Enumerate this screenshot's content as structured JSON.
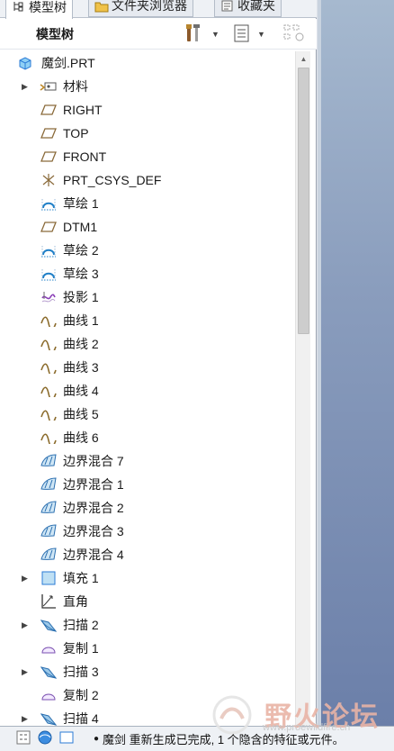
{
  "tabs": [
    {
      "label": "模型树",
      "icon": "model-tree-icon"
    },
    {
      "label": "文件夹浏览器",
      "icon": "folder-icon"
    },
    {
      "label": "收藏夹",
      "icon": "favorites-icon"
    }
  ],
  "header": {
    "title": "模型树"
  },
  "tree": {
    "root": "魔剑.PRT",
    "items": [
      {
        "label": "材料",
        "icon": "material-icon",
        "expandable": true
      },
      {
        "label": "RIGHT",
        "icon": "datum-plane-icon",
        "expandable": false
      },
      {
        "label": "TOP",
        "icon": "datum-plane-icon",
        "expandable": false
      },
      {
        "label": "FRONT",
        "icon": "datum-plane-icon",
        "expandable": false
      },
      {
        "label": "PRT_CSYS_DEF",
        "icon": "csys-icon",
        "expandable": false
      },
      {
        "label": "草绘 1",
        "icon": "sketch-icon",
        "expandable": false
      },
      {
        "label": "DTM1",
        "icon": "datum-plane-icon",
        "expandable": false
      },
      {
        "label": "草绘 2",
        "icon": "sketch-icon",
        "expandable": false
      },
      {
        "label": "草绘 3",
        "icon": "sketch-icon",
        "expandable": false
      },
      {
        "label": "投影 1",
        "icon": "projection-icon",
        "expandable": false
      },
      {
        "label": "曲线 1",
        "icon": "curve-icon",
        "expandable": false
      },
      {
        "label": "曲线 2",
        "icon": "curve-icon",
        "expandable": false
      },
      {
        "label": "曲线 3",
        "icon": "curve-icon",
        "expandable": false
      },
      {
        "label": "曲线 4",
        "icon": "curve-icon",
        "expandable": false
      },
      {
        "label": "曲线 5",
        "icon": "curve-icon",
        "expandable": false
      },
      {
        "label": "曲线 6",
        "icon": "curve-icon",
        "expandable": false
      },
      {
        "label": "边界混合 7",
        "icon": "boundary-blend-icon",
        "expandable": false
      },
      {
        "label": "边界混合 1",
        "icon": "boundary-blend-icon",
        "expandable": false
      },
      {
        "label": "边界混合 2",
        "icon": "boundary-blend-icon",
        "expandable": false
      },
      {
        "label": "边界混合 3",
        "icon": "boundary-blend-icon",
        "expandable": false
      },
      {
        "label": "边界混合 4",
        "icon": "boundary-blend-icon",
        "expandable": false
      },
      {
        "label": "填充 1",
        "icon": "fill-icon",
        "expandable": true
      },
      {
        "label": "直角",
        "icon": "corner-icon",
        "expandable": false
      },
      {
        "label": "扫描 2",
        "icon": "sweep-icon",
        "expandable": true
      },
      {
        "label": "复制 1",
        "icon": "copy-icon",
        "expandable": false
      },
      {
        "label": "扫描 3",
        "icon": "sweep-icon",
        "expandable": true
      },
      {
        "label": "复制 2",
        "icon": "copy-icon",
        "expandable": false
      },
      {
        "label": "扫描 4",
        "icon": "sweep-icon",
        "expandable": true
      }
    ]
  },
  "status": {
    "message": "魔剑 重新生成已完成, 1 个隐含的特征或元件。"
  },
  "watermark": {
    "text": "野火论坛",
    "url": "www.proewildfire.cn"
  },
  "colors": {
    "accent": "#2b7bd6",
    "sketch": "#1f7fc7",
    "plane": "#8a6a3a",
    "curve": "#8a6a2a"
  }
}
